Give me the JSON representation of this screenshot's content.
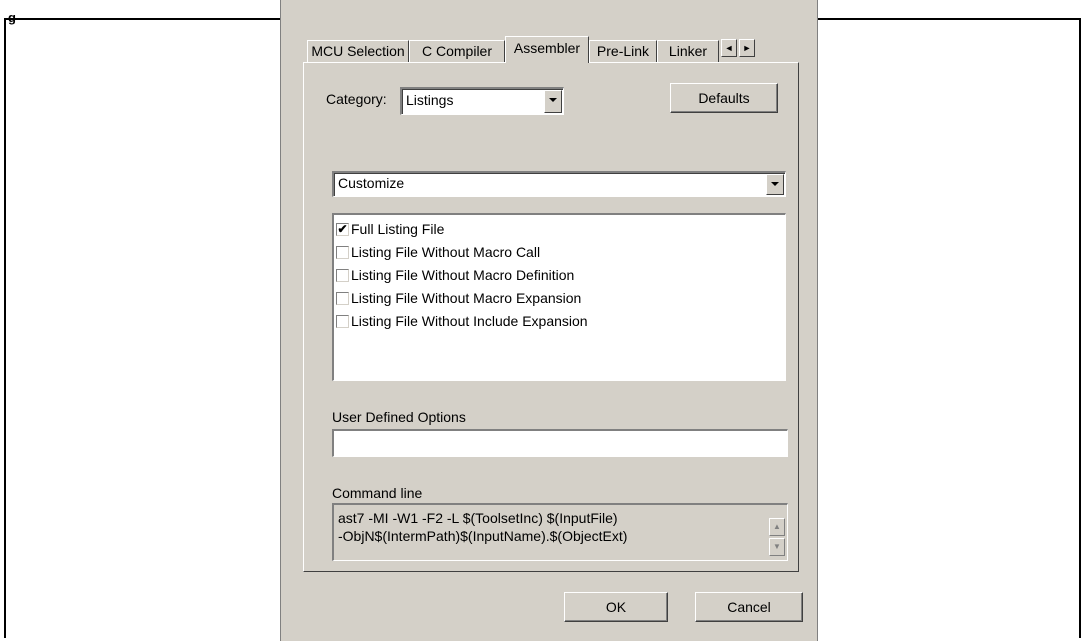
{
  "page": {
    "top_fragment": "g"
  },
  "tabs": {
    "items": [
      "MCU Selection",
      "C Compiler",
      "Assembler",
      "Pre-Link",
      "Linker"
    ],
    "active": "Assembler",
    "scroll_left_icon": "◄",
    "scroll_right_icon": "►"
  },
  "category": {
    "label": "Category:",
    "value": "Listings"
  },
  "defaults_button": "Defaults",
  "mode_select": {
    "value": "Customize"
  },
  "options": [
    {
      "label": "Full Listing File",
      "checked": true
    },
    {
      "label": "Listing File Without Macro Call",
      "checked": false
    },
    {
      "label": "Listing File Without Macro Definition",
      "checked": false
    },
    {
      "label": "Listing File Without Macro Expansion",
      "checked": false
    },
    {
      "label": "Listing File Without Include Expansion",
      "checked": false
    }
  ],
  "user_options": {
    "label": "User Defined Options",
    "value": ""
  },
  "command_line": {
    "label": "Command line",
    "lines": [
      "ast7  -MI -W1  -F2 -L $(ToolsetInc) $(InputFile)",
      "-ObjN$(IntermPath)$(InputName).$(ObjectExt)"
    ]
  },
  "buttons": {
    "ok": "OK",
    "cancel": "Cancel"
  },
  "check_glyph": "✔"
}
